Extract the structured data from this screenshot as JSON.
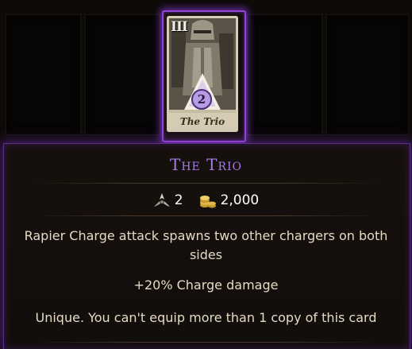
{
  "card": {
    "numeral": "III",
    "cost": "2",
    "name": "The Trio"
  },
  "panel": {
    "title": "The Trio",
    "stats": {
      "star_icon": "tri-star-icon",
      "star_value": "2",
      "gold_icon": "gold-coins-icon",
      "gold_value": "2,000"
    },
    "description": "Rapier Charge attack spawns two other chargers on both sides",
    "bonus": "+20% Charge damage",
    "restriction": "Unique. You can't equip more than 1 copy of this card"
  },
  "colors": {
    "accent_purple": "#a77ae6",
    "glow_purple": "#8f45d8",
    "body_text": "#e6d9c4"
  }
}
